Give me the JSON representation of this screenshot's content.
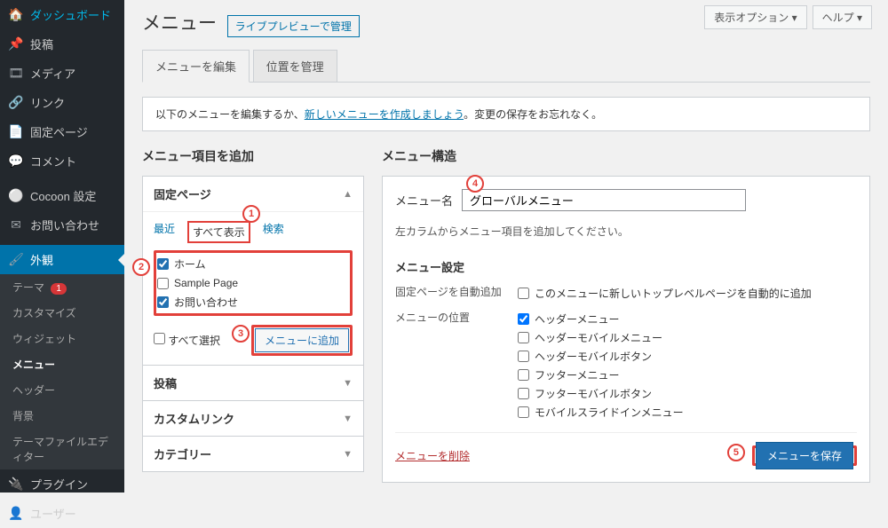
{
  "topbar": {
    "screen_options": "表示オプション ▾",
    "help": "ヘルプ ▾"
  },
  "header": {
    "title": "メニュー",
    "preview": "ライブプレビューで管理"
  },
  "tabs": {
    "edit": "メニューを編集",
    "locations": "位置を管理"
  },
  "notice": {
    "pre": "以下のメニューを編集するか、",
    "link": "新しいメニューを作成しましょう",
    "post": "。変更の保存をお忘れなく。"
  },
  "left": {
    "heading": "メニュー項目を追加",
    "acc_pages": "固定ページ",
    "subtab_recent": "最近",
    "subtab_all": "すべて表示",
    "subtab_search": "検索",
    "items": [
      {
        "label": "ホーム",
        "checked": true
      },
      {
        "label": "Sample Page",
        "checked": false
      },
      {
        "label": "お問い合わせ",
        "checked": true
      }
    ],
    "select_all": "すべて選択",
    "add_btn": "メニューに追加",
    "acc_posts": "投稿",
    "acc_custom": "カスタムリンク",
    "acc_cat": "カテゴリー"
  },
  "right": {
    "heading": "メニュー構造",
    "name_label": "メニュー名",
    "name_value": "グローバルメニュー",
    "hint": "左カラムからメニュー項目を追加してください。",
    "settings_heading": "メニュー設定",
    "auto_add_label": "固定ページを自動追加",
    "auto_add_text": "このメニューに新しいトップレベルページを自動的に追加",
    "location_label": "メニューの位置",
    "locations": [
      {
        "label": "ヘッダーメニュー",
        "checked": true
      },
      {
        "label": "ヘッダーモバイルメニュー",
        "checked": false
      },
      {
        "label": "ヘッダーモバイルボタン",
        "checked": false
      },
      {
        "label": "フッターメニュー",
        "checked": false
      },
      {
        "label": "フッターモバイルボタン",
        "checked": false
      },
      {
        "label": "モバイルスライドインメニュー",
        "checked": false
      }
    ],
    "delete": "メニューを削除",
    "save": "メニューを保存"
  },
  "sidebar": {
    "items": [
      {
        "icon": "🏠",
        "label": "ダッシュボード",
        "name": "sidebar-item-dashboard"
      },
      {
        "icon": "📌",
        "label": "投稿",
        "name": "sidebar-item-posts"
      },
      {
        "icon": "🎞",
        "label": "メディア",
        "name": "sidebar-item-media"
      },
      {
        "icon": "🔗",
        "label": "リンク",
        "name": "sidebar-item-links"
      },
      {
        "icon": "📄",
        "label": "固定ページ",
        "name": "sidebar-item-pages"
      },
      {
        "icon": "💬",
        "label": "コメント",
        "name": "sidebar-item-comments"
      },
      {
        "icon": "⚪",
        "label": "Cocoon 設定",
        "name": "sidebar-item-cocoon"
      },
      {
        "icon": "✉",
        "label": "お問い合わせ",
        "name": "sidebar-item-contact"
      }
    ],
    "active": {
      "icon": "🖌",
      "label": "外観"
    },
    "sub": [
      {
        "label": "テーマ",
        "badge": "1"
      },
      {
        "label": "カスタマイズ"
      },
      {
        "label": "ウィジェット"
      },
      {
        "label": "メニュー",
        "selected": true
      },
      {
        "label": "ヘッダー"
      },
      {
        "label": "背景"
      },
      {
        "label": "テーマファイルエディター"
      }
    ],
    "bottom": [
      {
        "icon": "🔌",
        "label": "プラグイン",
        "name": "sidebar-item-plugins"
      },
      {
        "icon": "👤",
        "label": "ユーザー",
        "name": "sidebar-item-users"
      }
    ]
  },
  "annotations": {
    "n1": "1",
    "n2": "2",
    "n3": "3",
    "n4": "4",
    "n5": "5"
  }
}
